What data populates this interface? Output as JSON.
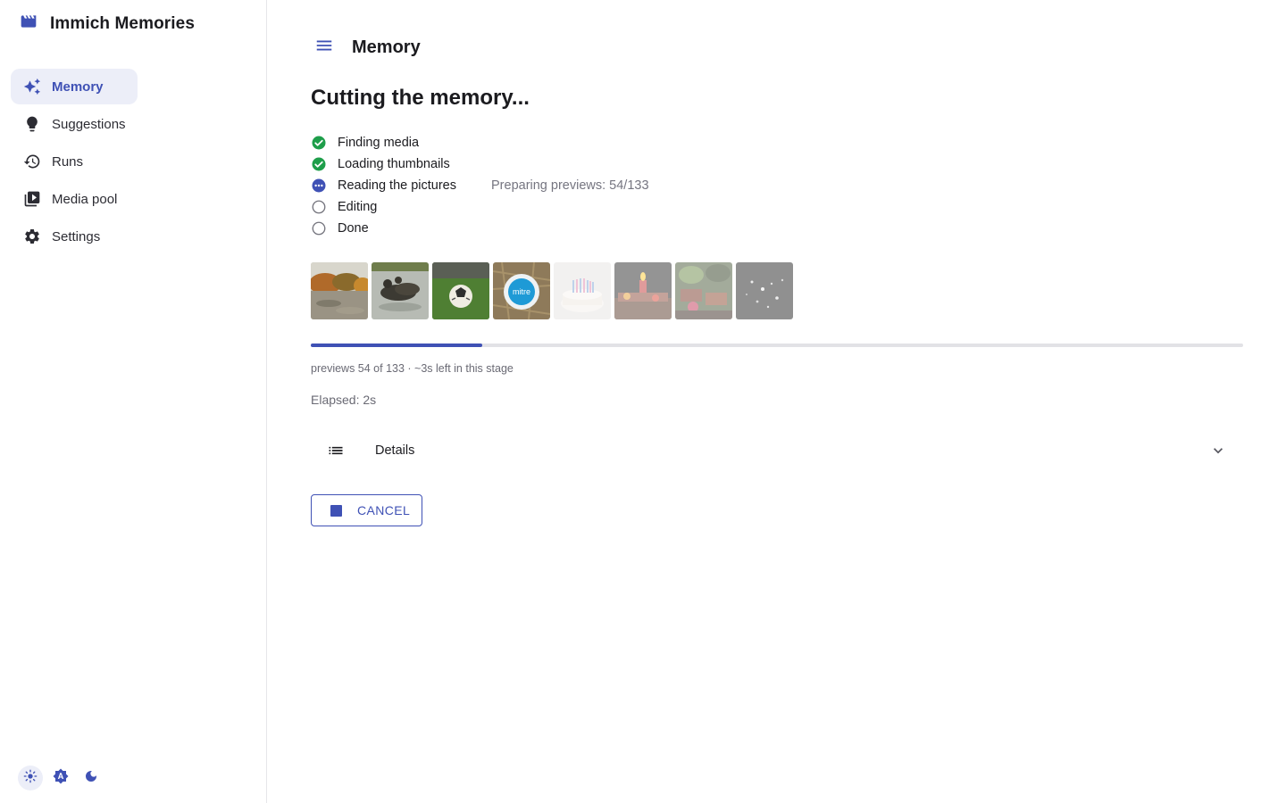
{
  "app": {
    "title": "Immich Memories",
    "brand_icon": "clapperboard-icon",
    "accent_color": "#3f51b5",
    "success_color": "#1e9e4a"
  },
  "sidebar": {
    "items": [
      {
        "label": "Memory",
        "icon": "sparkles-icon",
        "active": true
      },
      {
        "label": "Suggestions",
        "icon": "lightbulb-icon",
        "active": false
      },
      {
        "label": "Runs",
        "icon": "history-icon",
        "active": false
      },
      {
        "label": "Media pool",
        "icon": "video-library-icon",
        "active": false
      },
      {
        "label": "Settings",
        "icon": "gear-icon",
        "active": false
      }
    ],
    "theme_modes": [
      {
        "icon": "sun-icon",
        "active": true
      },
      {
        "icon": "auto-theme-icon",
        "active": false
      },
      {
        "icon": "moon-icon",
        "active": false
      }
    ]
  },
  "header": {
    "title": "Memory",
    "menu_icon": "hamburger-icon"
  },
  "main": {
    "heading": "Cutting the memory...",
    "steps": [
      {
        "label": "Finding media",
        "status": "done",
        "detail": ""
      },
      {
        "label": "Loading thumbnails",
        "status": "done",
        "detail": ""
      },
      {
        "label": "Reading the pictures",
        "status": "in-progress",
        "detail": "Preparing previews: 54/133"
      },
      {
        "label": "Editing",
        "status": "pending",
        "detail": ""
      },
      {
        "label": "Done",
        "status": "pending",
        "detail": ""
      }
    ],
    "thumbnails": [
      {
        "subject": "autumn-lake",
        "dim": false
      },
      {
        "subject": "ducks",
        "dim": false
      },
      {
        "subject": "football",
        "dim": false
      },
      {
        "subject": "mitre-ball",
        "dim": false
      },
      {
        "subject": "birthday-cake",
        "dim": true
      },
      {
        "subject": "candle-cake",
        "dim": true
      },
      {
        "subject": "food-table",
        "dim": true
      },
      {
        "subject": "sparkles-dark",
        "dim": true
      }
    ],
    "progress": {
      "fraction": 0.184,
      "note": "previews 54 of 133 · ~3s left in this stage"
    },
    "elapsed": "Elapsed: 2s",
    "details": {
      "label": "Details",
      "icon": "list-icon",
      "chevron": "chevron-down-icon"
    },
    "cancel": {
      "label": "CANCEL",
      "icon": "stop-icon"
    }
  }
}
